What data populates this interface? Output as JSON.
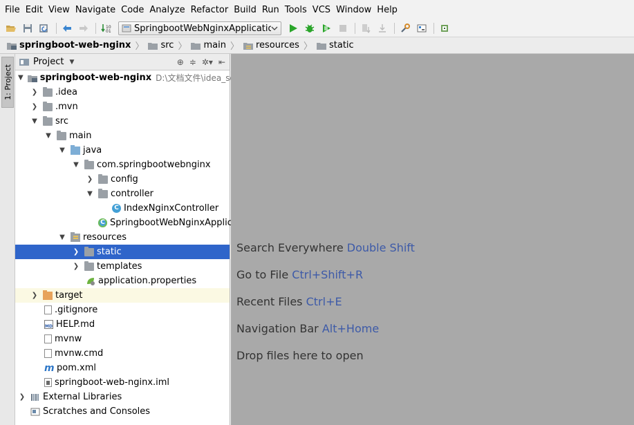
{
  "menu": [
    "File",
    "Edit",
    "View",
    "Navigate",
    "Code",
    "Analyze",
    "Refactor",
    "Build",
    "Run",
    "Tools",
    "VCS",
    "Window",
    "Help"
  ],
  "toolbar": {
    "run_config": "SpringbootWebNginxApplication"
  },
  "breadcrumb": [
    "springboot-web-nginx",
    "src",
    "main",
    "resources",
    "static"
  ],
  "left_strip": {
    "project_tab": "1: Project"
  },
  "project_panel": {
    "title": "Project",
    "tree": [
      {
        "label": "springboot-web-nginx",
        "path": "D:\\文档文件\\idea_sour",
        "bold": true
      },
      {
        "label": ".idea"
      },
      {
        "label": ".mvn"
      },
      {
        "label": "src"
      },
      {
        "label": "main"
      },
      {
        "label": "java"
      },
      {
        "label": "com.springbootwebnginx"
      },
      {
        "label": "config"
      },
      {
        "label": "controller"
      },
      {
        "label": "IndexNginxController"
      },
      {
        "label": "SpringbootWebNginxApplica"
      },
      {
        "label": "resources"
      },
      {
        "label": "static"
      },
      {
        "label": "templates"
      },
      {
        "label": "application.properties"
      },
      {
        "label": "target"
      },
      {
        "label": ".gitignore"
      },
      {
        "label": "HELP.md"
      },
      {
        "label": "mvnw"
      },
      {
        "label": "mvnw.cmd"
      },
      {
        "label": "pom.xml"
      },
      {
        "label": "springboot-web-nginx.iml"
      },
      {
        "label": "External Libraries"
      },
      {
        "label": "Scratches and Consoles"
      }
    ]
  },
  "editor_hints": [
    {
      "text": "Search Everywhere",
      "shortcut": "Double Shift"
    },
    {
      "text": "Go to File",
      "shortcut": "Ctrl+Shift+R"
    },
    {
      "text": "Recent Files",
      "shortcut": "Ctrl+E"
    },
    {
      "text": "Navigation Bar",
      "shortcut": "Alt+Home"
    },
    {
      "text": "Drop files here to open",
      "shortcut": ""
    }
  ],
  "colors": {
    "selection": "#2f65ca",
    "shortcut": "#3d5aa8",
    "editor_bg": "#a9a9a9",
    "run_green": "#2aa52a"
  },
  "icons": [
    "folder-open-icon",
    "save-icon",
    "sync-icon",
    "back-icon",
    "forward-icon",
    "build-icon",
    "run-icon",
    "debug-icon",
    "coverage-icon",
    "stop-icon",
    "settings-icon",
    "project-structure-icon",
    "sdk-icon"
  ]
}
